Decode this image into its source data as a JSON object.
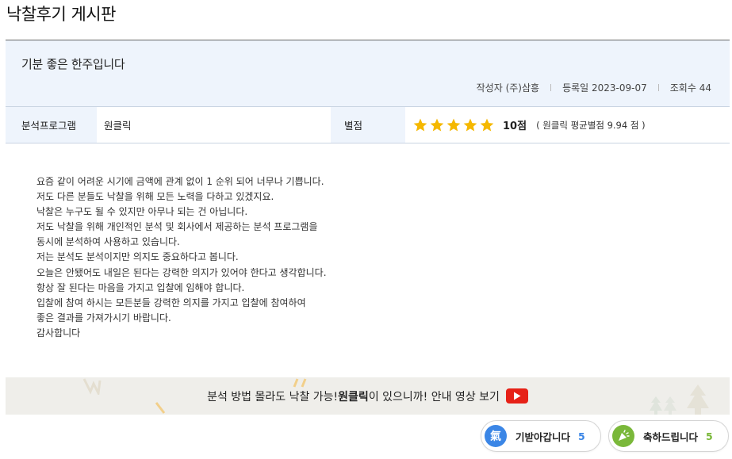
{
  "board": {
    "title": "낙찰후기 게시판"
  },
  "post": {
    "title": "기분 좋은 한주입니다",
    "author_label": "작성자",
    "author": "(주)삼흥",
    "date_label": "등록일",
    "date": "2023-09-07",
    "views_label": "조회수",
    "views": "44"
  },
  "info": {
    "program_label": "분석프로그램",
    "program_value": "원클릭",
    "rating_label": "별점",
    "rating_stars": 5,
    "rating_max": 5,
    "rating_score": "10점",
    "rating_avg": "( 원클릭 평균별점 9.94 점 )",
    "star_color": "#f5b800"
  },
  "content": {
    "lines": [
      "요즘 같이 어려운 시기에 금액에 관계 없이 1 순위 되어 너무나 기쁩니다.",
      "저도 다른 분들도 낙찰을 위해 모든 노력을 다하고 있겠지요.",
      "낙찰은 누구도 될 수 있지만 아무나 되는 건 아닙니다.",
      "저도 낙찰을 위해 개인적인 분석 및 회사에서 제공하는 분석 프로그램을",
      "동시에 분석하여 사용하고 있습니다.",
      "저는 분석도 분석이지만 의지도 중요하다고 봅니다.",
      "오늘은 안됐어도 내일은 된다는 강력한 의지가 있어야 한다고 생각합니다.",
      "항상 잘 된다는 마음을 가지고 입찰에 임해야 합니다.",
      "입찰에 참여 하시는 모든분들 강력한 의지를 가지고 입찰에 참여하여",
      "좋은 결과를 가져가시기 바랍니다.",
      "감사합니다"
    ]
  },
  "banner": {
    "text_before": "분석 방법 몰라도 낙찰 가능! ",
    "text_bold": "원클릭",
    "text_after": "이 있으니까! 안내 영상 보기",
    "icon": "youtube-play-icon"
  },
  "reactions": [
    {
      "icon": "ki-icon",
      "icon_char": "氣",
      "label": "기받아갑니다",
      "count": "5",
      "color": "#3b86e6"
    },
    {
      "icon": "party-popper-icon",
      "label": "축하드립니다",
      "count": "5",
      "color": "#7ab83a"
    }
  ]
}
